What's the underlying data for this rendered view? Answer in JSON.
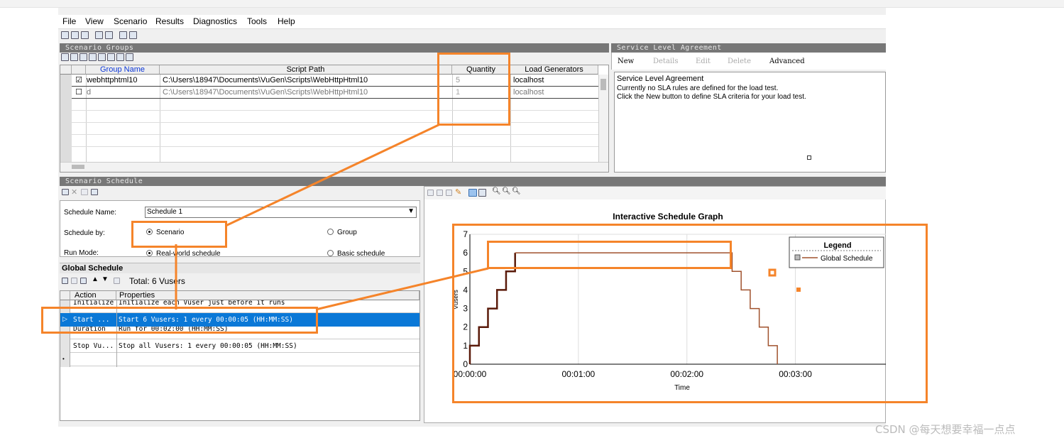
{
  "menu": [
    "File",
    "View",
    "Scenario",
    "Results",
    "Diagnostics",
    "Tools",
    "Help"
  ],
  "scenario_groups": {
    "title": "Scenario Groups",
    "columns": [
      "Group Name",
      "Script Path",
      "Quantity",
      "Load Generators"
    ],
    "rows": [
      {
        "checked": "☑",
        "name": "webhttphtml10",
        "path": "C:\\Users\\18947\\Documents\\VuGen\\Scripts\\WebHttpHtml10",
        "qty": "5",
        "gen": "localhost"
      },
      {
        "checked": "☐",
        "name": "d",
        "path": "C:\\Users\\18947\\Documents\\VuGen\\Scripts\\WebHttpHtml10",
        "qty": "1",
        "gen": "localhost"
      }
    ]
  },
  "sla": {
    "title": "Service Level Agreement",
    "buttons": [
      "New",
      "Details",
      "Edit",
      "Delete",
      "Advanced"
    ],
    "heading": "Service Level Agreement",
    "line1": "Currently no SLA rules are defined for the load test.",
    "line2": "Click the New button to define SLA criteria for your load test."
  },
  "schedule": {
    "title": "Scenario Schedule",
    "name_label": "Schedule Name:",
    "name_value": "Schedule 1",
    "by_label": "Schedule by:",
    "by_scenario": "Scenario",
    "by_group": "Group",
    "mode_label": "Run Mode:",
    "mode_real": "Real-world schedule",
    "mode_basic": "Basic schedule",
    "global_title": "Global Schedule",
    "total": "Total: 6 Vusers",
    "columns": [
      "Action",
      "Properties"
    ],
    "rows": [
      {
        "action": "Initialize",
        "props": "Initialize each Vuser just before it runs"
      },
      {
        "action": "Start  ...",
        "props": "Start 6 Vusers: 1 every 00:00:05 (HH:MM:SS)"
      },
      {
        "action": "Duration",
        "props": "Run for 00:02:00 (HH:MM:SS)"
      },
      {
        "action": "Stop Vu...",
        "props": "Stop all Vusers: 1 every 00:00:05 (HH:MM:SS)"
      }
    ]
  },
  "chart_data": {
    "type": "line",
    "title": "Interactive Schedule Graph",
    "xlabel": "Time",
    "ylabel": "Vusers",
    "xlim": [
      0,
      200
    ],
    "ylim": [
      0,
      7
    ],
    "x_tick_labels": [
      "00:00:00",
      "00:01:00",
      "00:02:00",
      "00:03:00"
    ],
    "y_ticks": [
      0,
      1,
      2,
      3,
      4,
      5,
      6,
      7
    ],
    "legend_title": "Legend",
    "legend_position": "top-right",
    "series": [
      {
        "name": "Global Schedule",
        "color": "#a0522d",
        "x": [
          0,
          0,
          5,
          5,
          10,
          10,
          15,
          15,
          20,
          20,
          25,
          25,
          145,
          145,
          150,
          150,
          155,
          155,
          160,
          160,
          165,
          165,
          170,
          170
        ],
        "y": [
          0,
          1,
          1,
          2,
          2,
          3,
          3,
          4,
          4,
          5,
          5,
          6,
          6,
          5,
          5,
          4,
          4,
          3,
          3,
          2,
          2,
          1,
          1,
          0
        ]
      }
    ]
  },
  "watermark": "CSDN @每天想要幸福一点点"
}
